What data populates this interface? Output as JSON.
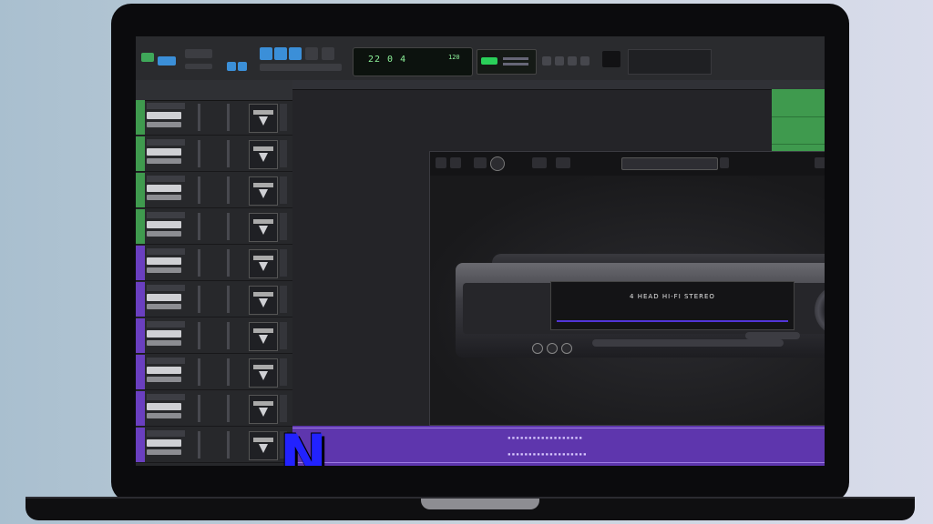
{
  "window": {
    "title": ""
  },
  "transport": {
    "counter_main": "22 0 4",
    "counter_sub": "120"
  },
  "plugin": {
    "preset_label": "",
    "footer": "",
    "device": {
      "brand": "",
      "display_line1": "4 HEAD  HI-FI STEREO",
      "display_line2": ""
    }
  },
  "overlay_logo": "N",
  "colors": {
    "bezel": "#0b0b0d",
    "track_green": "#3f9a4e",
    "track_purple": "#6a3fc0",
    "transport_blue": "#3b8fd8",
    "display_bar": "#5236d8",
    "logo_blue": "#2222ff"
  },
  "tracks": [
    {
      "color": "#3f9a4e"
    },
    {
      "color": "#3f9a4e"
    },
    {
      "color": "#3f9a4e"
    },
    {
      "color": "#3f9a4e"
    },
    {
      "color": "#6a3fc0"
    },
    {
      "color": "#6a3fc0"
    },
    {
      "color": "#6a3fc0"
    },
    {
      "color": "#6a3fc0"
    },
    {
      "color": "#6a3fc0"
    },
    {
      "color": "#6a3fc0"
    }
  ]
}
